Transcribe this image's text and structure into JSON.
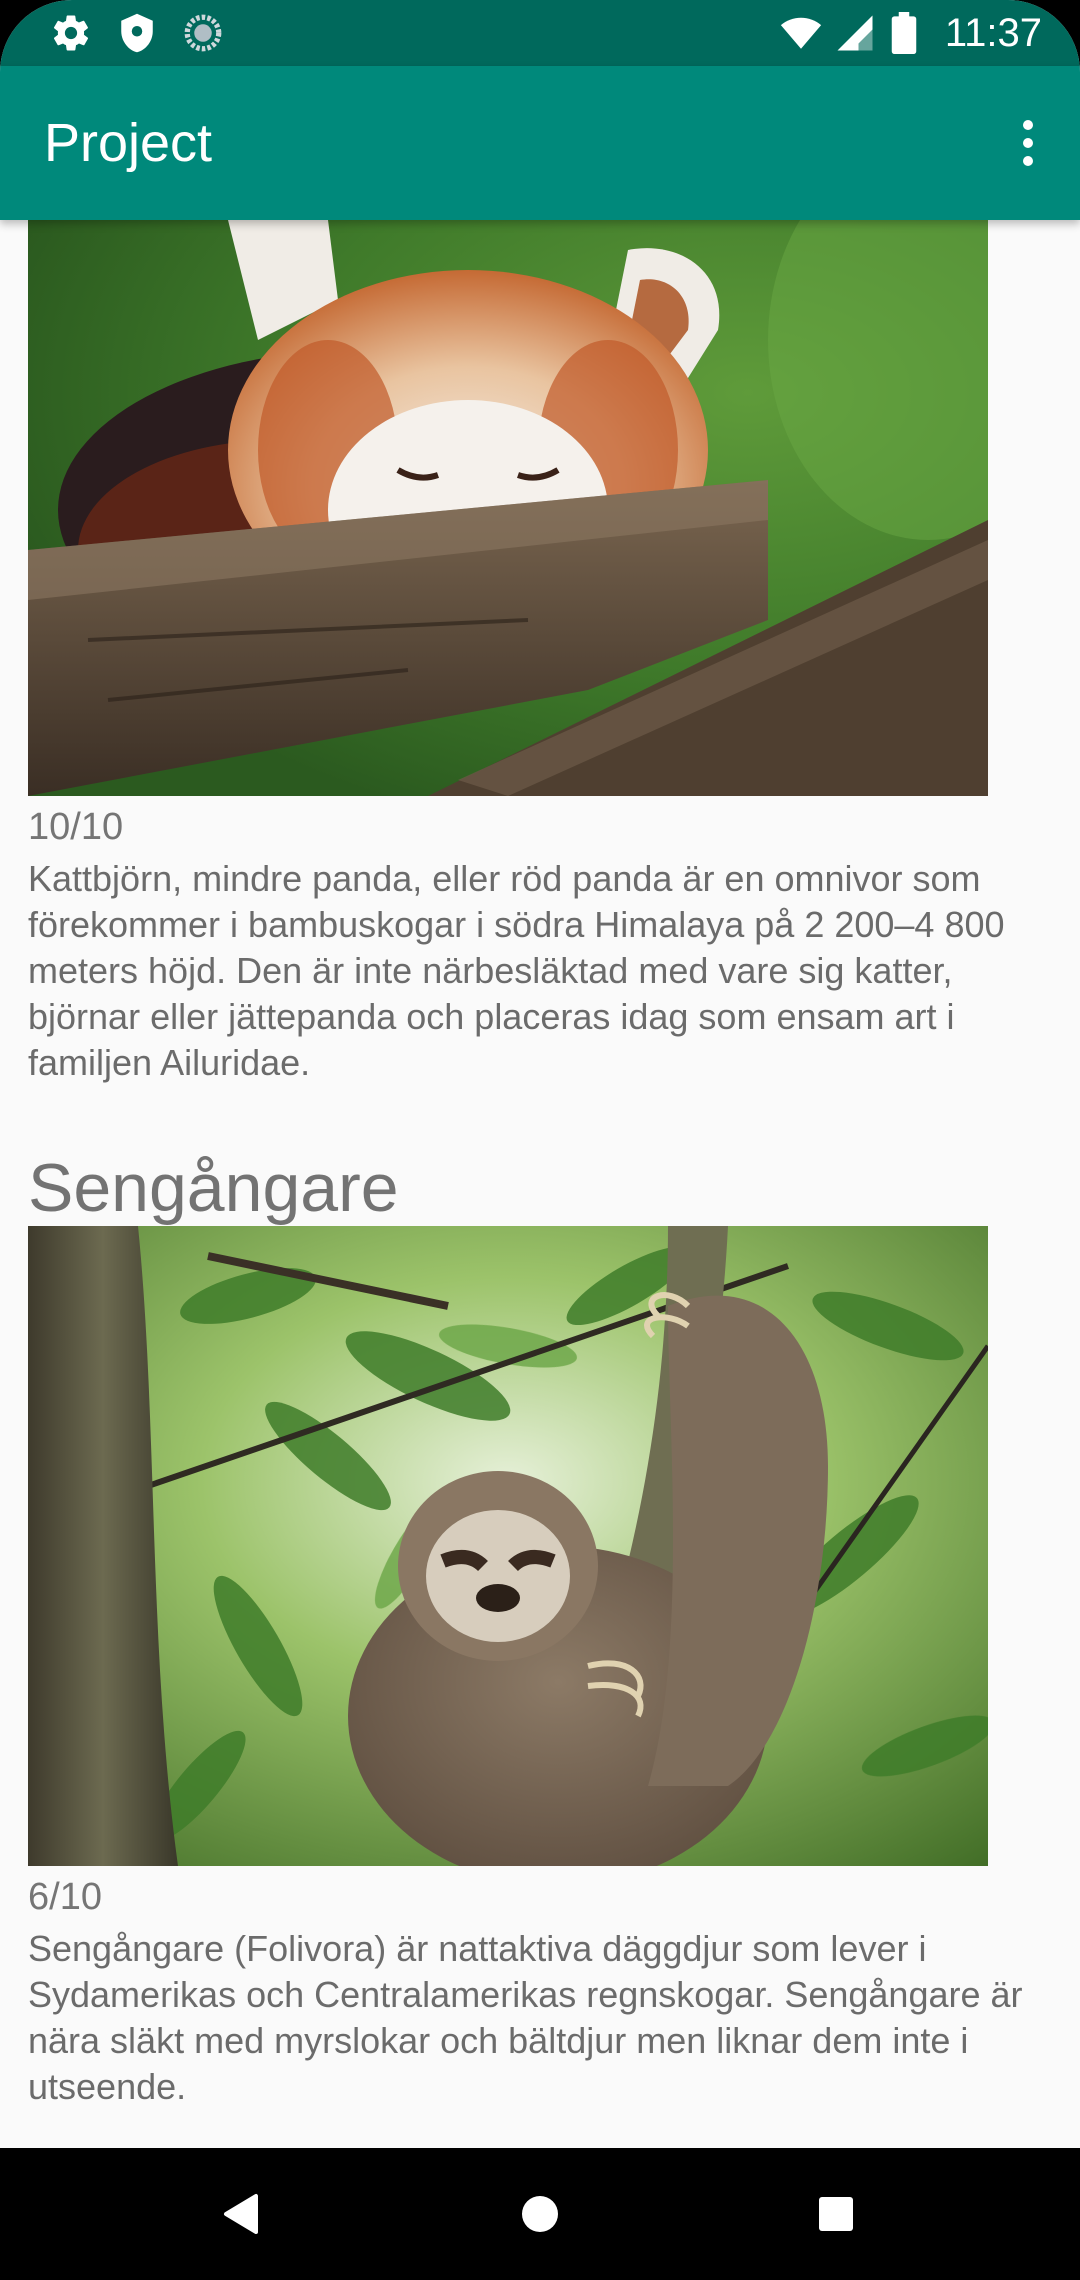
{
  "status_bar": {
    "time": "11:37",
    "icons": [
      "gear-icon",
      "shield-icon",
      "sync-circle-icon",
      "wifi-icon",
      "signal-icon",
      "battery-icon"
    ]
  },
  "app_bar": {
    "title": "Project",
    "menu_icon": "more-vert-icon"
  },
  "items": [
    {
      "title": "",
      "image": "red-panda-photo",
      "rating": "10/10",
      "description": "Kattbjörn, mindre panda, eller röd panda är en omnivor som förekommer i bambuskogar i södra Himalaya på 2 200–4 800 meters höjd. Den är inte närbesläktad med vare sig katter, björnar eller jättepanda och placeras idag som ensam art i familjen Ailuridae."
    },
    {
      "title": "Sengångare",
      "image": "sloth-photo",
      "rating": "6/10",
      "description": "Sengångare (Folivora) är nattaktiva däggdjur som lever i Sydamerikas och Centralamerikas regnskogar. Sengångare är nära släkt med myrslokar och bältdjur men liknar dem inte i utseende."
    }
  ],
  "nav_bar": {
    "icons": [
      "back-triangle-icon",
      "home-circle-icon",
      "recents-square-icon"
    ]
  },
  "colors": {
    "status_bar": "#00695c",
    "app_bar": "#00897b",
    "background": "#fafafa",
    "text": "#737373"
  }
}
